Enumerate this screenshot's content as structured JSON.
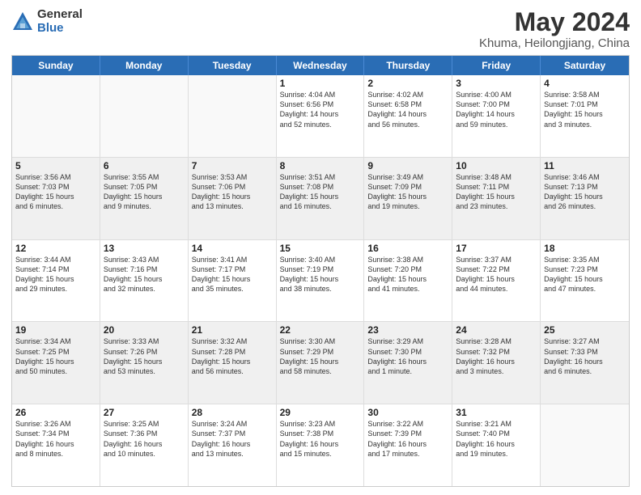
{
  "logo": {
    "general": "General",
    "blue": "Blue"
  },
  "title": "May 2024",
  "location": "Khuma, Heilongjiang, China",
  "days_of_week": [
    "Sunday",
    "Monday",
    "Tuesday",
    "Wednesday",
    "Thursday",
    "Friday",
    "Saturday"
  ],
  "weeks": [
    [
      {
        "day": "",
        "text": ""
      },
      {
        "day": "",
        "text": ""
      },
      {
        "day": "",
        "text": ""
      },
      {
        "day": "1",
        "text": "Sunrise: 4:04 AM\nSunset: 6:56 PM\nDaylight: 14 hours\nand 52 minutes."
      },
      {
        "day": "2",
        "text": "Sunrise: 4:02 AM\nSunset: 6:58 PM\nDaylight: 14 hours\nand 56 minutes."
      },
      {
        "day": "3",
        "text": "Sunrise: 4:00 AM\nSunset: 7:00 PM\nDaylight: 14 hours\nand 59 minutes."
      },
      {
        "day": "4",
        "text": "Sunrise: 3:58 AM\nSunset: 7:01 PM\nDaylight: 15 hours\nand 3 minutes."
      }
    ],
    [
      {
        "day": "5",
        "text": "Sunrise: 3:56 AM\nSunset: 7:03 PM\nDaylight: 15 hours\nand 6 minutes."
      },
      {
        "day": "6",
        "text": "Sunrise: 3:55 AM\nSunset: 7:05 PM\nDaylight: 15 hours\nand 9 minutes."
      },
      {
        "day": "7",
        "text": "Sunrise: 3:53 AM\nSunset: 7:06 PM\nDaylight: 15 hours\nand 13 minutes."
      },
      {
        "day": "8",
        "text": "Sunrise: 3:51 AM\nSunset: 7:08 PM\nDaylight: 15 hours\nand 16 minutes."
      },
      {
        "day": "9",
        "text": "Sunrise: 3:49 AM\nSunset: 7:09 PM\nDaylight: 15 hours\nand 19 minutes."
      },
      {
        "day": "10",
        "text": "Sunrise: 3:48 AM\nSunset: 7:11 PM\nDaylight: 15 hours\nand 23 minutes."
      },
      {
        "day": "11",
        "text": "Sunrise: 3:46 AM\nSunset: 7:13 PM\nDaylight: 15 hours\nand 26 minutes."
      }
    ],
    [
      {
        "day": "12",
        "text": "Sunrise: 3:44 AM\nSunset: 7:14 PM\nDaylight: 15 hours\nand 29 minutes."
      },
      {
        "day": "13",
        "text": "Sunrise: 3:43 AM\nSunset: 7:16 PM\nDaylight: 15 hours\nand 32 minutes."
      },
      {
        "day": "14",
        "text": "Sunrise: 3:41 AM\nSunset: 7:17 PM\nDaylight: 15 hours\nand 35 minutes."
      },
      {
        "day": "15",
        "text": "Sunrise: 3:40 AM\nSunset: 7:19 PM\nDaylight: 15 hours\nand 38 minutes."
      },
      {
        "day": "16",
        "text": "Sunrise: 3:38 AM\nSunset: 7:20 PM\nDaylight: 15 hours\nand 41 minutes."
      },
      {
        "day": "17",
        "text": "Sunrise: 3:37 AM\nSunset: 7:22 PM\nDaylight: 15 hours\nand 44 minutes."
      },
      {
        "day": "18",
        "text": "Sunrise: 3:35 AM\nSunset: 7:23 PM\nDaylight: 15 hours\nand 47 minutes."
      }
    ],
    [
      {
        "day": "19",
        "text": "Sunrise: 3:34 AM\nSunset: 7:25 PM\nDaylight: 15 hours\nand 50 minutes."
      },
      {
        "day": "20",
        "text": "Sunrise: 3:33 AM\nSunset: 7:26 PM\nDaylight: 15 hours\nand 53 minutes."
      },
      {
        "day": "21",
        "text": "Sunrise: 3:32 AM\nSunset: 7:28 PM\nDaylight: 15 hours\nand 56 minutes."
      },
      {
        "day": "22",
        "text": "Sunrise: 3:30 AM\nSunset: 7:29 PM\nDaylight: 15 hours\nand 58 minutes."
      },
      {
        "day": "23",
        "text": "Sunrise: 3:29 AM\nSunset: 7:30 PM\nDaylight: 16 hours\nand 1 minute."
      },
      {
        "day": "24",
        "text": "Sunrise: 3:28 AM\nSunset: 7:32 PM\nDaylight: 16 hours\nand 3 minutes."
      },
      {
        "day": "25",
        "text": "Sunrise: 3:27 AM\nSunset: 7:33 PM\nDaylight: 16 hours\nand 6 minutes."
      }
    ],
    [
      {
        "day": "26",
        "text": "Sunrise: 3:26 AM\nSunset: 7:34 PM\nDaylight: 16 hours\nand 8 minutes."
      },
      {
        "day": "27",
        "text": "Sunrise: 3:25 AM\nSunset: 7:36 PM\nDaylight: 16 hours\nand 10 minutes."
      },
      {
        "day": "28",
        "text": "Sunrise: 3:24 AM\nSunset: 7:37 PM\nDaylight: 16 hours\nand 13 minutes."
      },
      {
        "day": "29",
        "text": "Sunrise: 3:23 AM\nSunset: 7:38 PM\nDaylight: 16 hours\nand 15 minutes."
      },
      {
        "day": "30",
        "text": "Sunrise: 3:22 AM\nSunset: 7:39 PM\nDaylight: 16 hours\nand 17 minutes."
      },
      {
        "day": "31",
        "text": "Sunrise: 3:21 AM\nSunset: 7:40 PM\nDaylight: 16 hours\nand 19 minutes."
      },
      {
        "day": "",
        "text": ""
      }
    ]
  ]
}
